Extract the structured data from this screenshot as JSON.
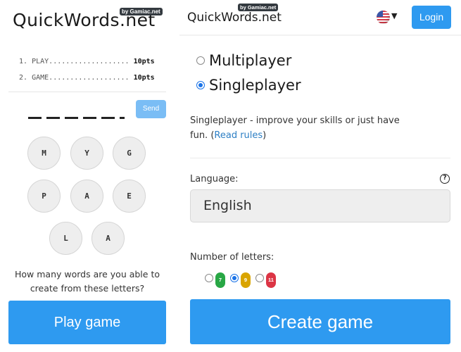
{
  "left": {
    "logo": "QuickWords.net",
    "badge": "by Gamiac.net",
    "scores": [
      {
        "rank": "1.",
        "word": "PLAY",
        "dots": "...................",
        "points": "10pts"
      },
      {
        "rank": "2.",
        "word": "GAME",
        "dots": "...................",
        "points": "10pts"
      }
    ],
    "send_label": "Send",
    "answer_slots": 6,
    "letters": [
      "M",
      "Y",
      "G",
      "P",
      "A",
      "E",
      "L",
      "A"
    ],
    "question": "How many words are you able to create from these letters?",
    "play_label": "Play game"
  },
  "right": {
    "logo": "QuickWords.net",
    "badge": "by Gamiac.net",
    "flag_icon": "us-flag-icon",
    "login_label": "Login",
    "modes": [
      {
        "label": "Multiplayer",
        "checked": false
      },
      {
        "label": "Singleplayer",
        "checked": true
      }
    ],
    "description": "Singleplayer - improve your skills or just have fun. ",
    "read_rules_label": "Read rules",
    "language_label": "Language:",
    "language_value": "English",
    "letters_label": "Number of letters:",
    "letter_options": [
      {
        "value": "7",
        "color": "#28a745",
        "checked": false
      },
      {
        "value": "9",
        "color": "#d9a400",
        "checked": true
      },
      {
        "value": "11",
        "color": "#dc3545",
        "checked": false
      }
    ],
    "create_label": "Create game"
  },
  "colors": {
    "primary": "#2e9af0",
    "send_disabled": "#7abdf5",
    "link": "#2d7fc4"
  }
}
